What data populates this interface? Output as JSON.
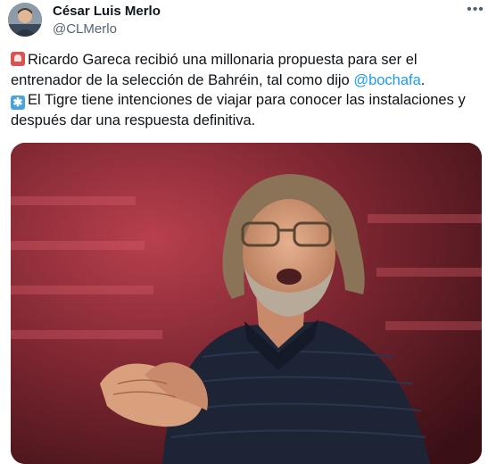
{
  "author": {
    "name": "César Luis Merlo",
    "handle": "@CLMerlo",
    "avatar_icon": "avatar-photo"
  },
  "more_icon": "more-options-icon",
  "tweet": {
    "line1": "Ricardo Gareca recibió una millonaria propuesta para ser el",
    "line2_prefix": "entrenador de la selección de Bahréin, tal como dijo ",
    "mention": "@bochafa",
    "line2_suffix": ".",
    "line3": "El Tigre tiene intenciones de viajar para conocer las instalaciones y",
    "line4": "después dar una respuesta definitiva.",
    "emoji1": "police-light-emoji",
    "emoji2": "asterisk-emoji"
  },
  "media": {
    "description_icon": "photo-of-coach-clapping"
  },
  "colors": {
    "text": "#0f1419",
    "secondary": "#536471",
    "mention": "#1d9bf0",
    "background": "#ffffff"
  }
}
